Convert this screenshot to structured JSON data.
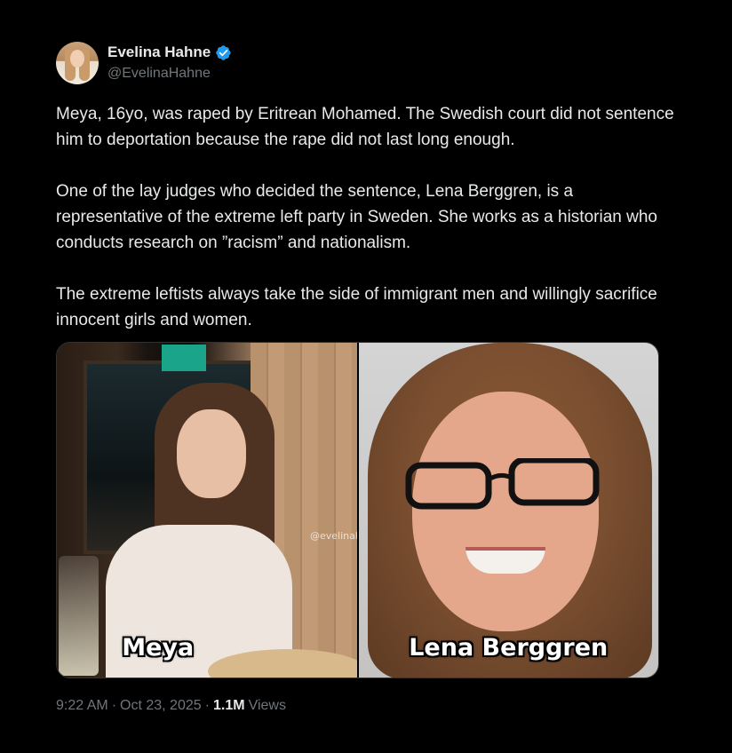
{
  "author": {
    "display_name": "Evelina Hahne",
    "handle": "@EvelinaHahne",
    "verified_color": "#1d9bf0"
  },
  "tweet": {
    "paragraphs": [
      "Meya, 16yo, was raped by Eritrean Mohamed. The Swedish court did not sentence him to deportation because the rape did not last long enough.",
      "One of the lay judges who decided the sentence, Lena Berggren, is a representative of the extreme left party in Sweden. She works as a historian who conducts research on ”racism” and nationalism.",
      "The extreme leftists always take the side of immigrant men and willingly sacrifice innocent girls and women."
    ]
  },
  "media": {
    "left_caption": "Meya",
    "right_caption": "Lena Berggren",
    "watermark": "@evelinahahne"
  },
  "meta": {
    "time": "9:22 AM",
    "date": "Oct 23, 2025",
    "views_count": "1.1M",
    "views_label": "Views",
    "separator": "·"
  }
}
